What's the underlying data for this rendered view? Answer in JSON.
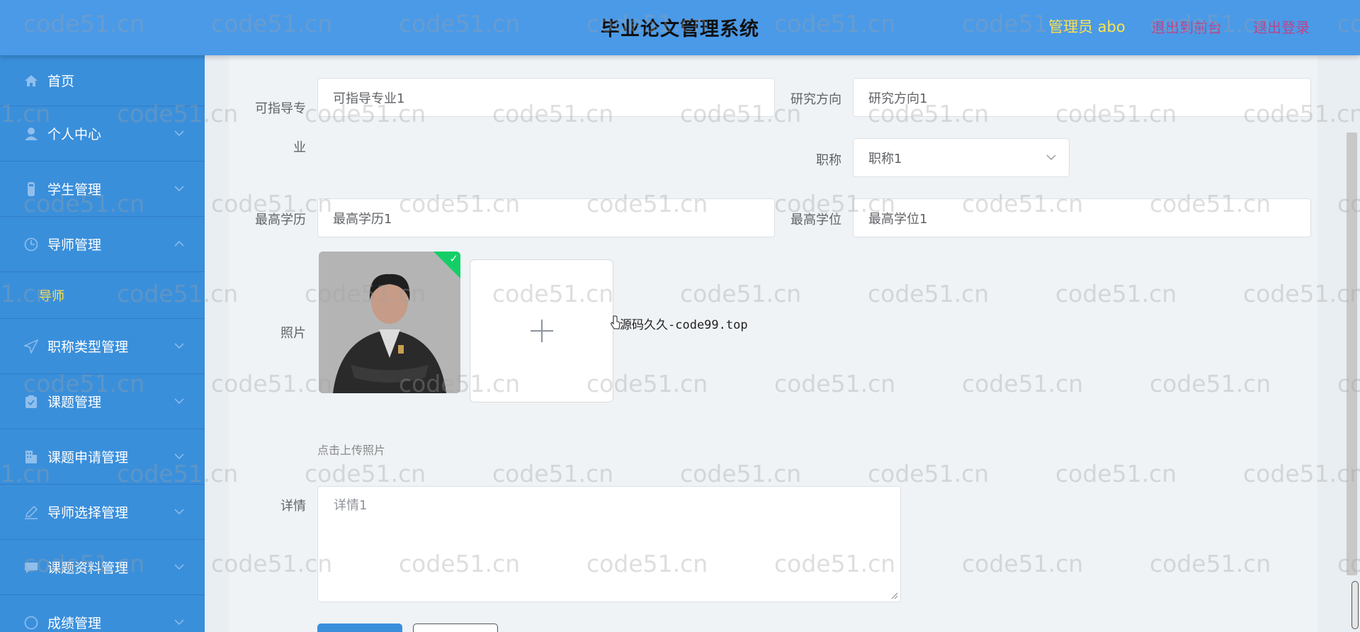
{
  "header": {
    "title": "毕业论文管理系统",
    "admin": "管理员 abo",
    "back_label": "退出到前台",
    "logout_label": "退出登录"
  },
  "sidebar": {
    "items": [
      {
        "label": "首页",
        "icon": "home-icon"
      },
      {
        "label": "个人中心",
        "icon": "user-icon"
      },
      {
        "label": "学生管理",
        "icon": "student-icon"
      },
      {
        "label": "导师管理",
        "icon": "clock-icon"
      },
      {
        "label": "职称类型管理",
        "icon": "send-icon"
      },
      {
        "label": "课题管理",
        "icon": "clipboard-icon"
      },
      {
        "label": "课题申请管理",
        "icon": "building-icon"
      },
      {
        "label": "导师选择管理",
        "icon": "edit-icon"
      },
      {
        "label": "课题资料管理",
        "icon": "chat-icon"
      },
      {
        "label": "成绩管理",
        "icon": "grade-icon"
      }
    ],
    "submenu_item": "导师"
  },
  "form": {
    "major_label": "可指导专业",
    "major_value": "可指导专业1",
    "research_label": "研究方向",
    "research_value": "研究方向1",
    "title_label": "职称",
    "title_value": "职称1",
    "education_label": "最高学历",
    "education_value": "最高学历1",
    "degree_label": "最高学位",
    "degree_value": "最高学位1",
    "photo_label": "照片",
    "upload_tip": "点击上传照片",
    "detail_label": "详情",
    "detail_value": "详情1"
  },
  "overlay_text": "源码久久-code99.top",
  "watermark": "code51.cn",
  "colors": {
    "header_bg": "#4a9ae8",
    "sidebar_bg": "#3a8fdb",
    "highlight": "#ffe44d",
    "link": "#b5478e",
    "success": "#13ce66"
  }
}
